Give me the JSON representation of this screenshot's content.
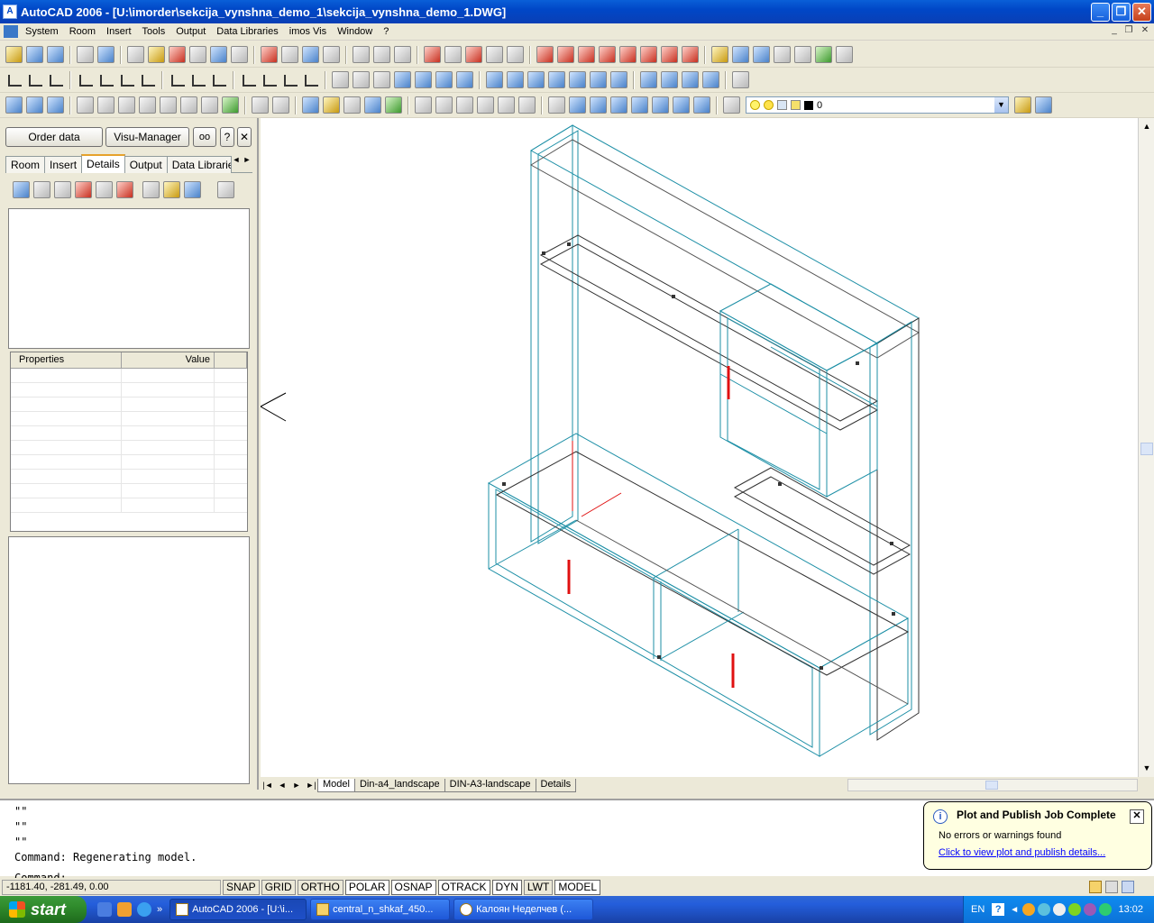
{
  "window": {
    "title": "AutoCAD 2006 - [U:\\imorder\\sekcija_vynshna_demo_1\\sekcija_vynshna_demo_1.DWG]"
  },
  "menu": [
    "System",
    "Room",
    "Insert",
    "Tools",
    "Output",
    "Data Libraries",
    "imos Vis",
    "Window",
    "?"
  ],
  "layer": {
    "current": "0"
  },
  "panel": {
    "order_button": "Order data",
    "visu_button": "Visu-Manager",
    "help_button": "?",
    "close_button": "✕",
    "tabs": [
      "Room",
      "Insert",
      "Details",
      "Output",
      "Data Libraries"
    ],
    "active_tab": "Details",
    "props_header": {
      "name": "Properties",
      "value": "Value"
    }
  },
  "layouts": {
    "tabs": [
      "Model",
      "Din-a4_landscape",
      "DIN-A3-landscape",
      "Details"
    ],
    "active": "Model"
  },
  "command": {
    "history": [
      "\"\"",
      "\"\"",
      "\"\"",
      "Command: Regenerating model."
    ],
    "prompt": "Command:"
  },
  "balloon": {
    "title": "Plot and Publish Job Complete",
    "message": "No errors or warnings found",
    "link": "Click to view plot and publish details..."
  },
  "status": {
    "coords": "-1181.40, -281.49, 0.00",
    "toggles": [
      {
        "label": "SNAP",
        "on": false
      },
      {
        "label": "GRID",
        "on": false
      },
      {
        "label": "ORTHO",
        "on": false
      },
      {
        "label": "POLAR",
        "on": true
      },
      {
        "label": "OSNAP",
        "on": true
      },
      {
        "label": "OTRACK",
        "on": true
      },
      {
        "label": "DYN",
        "on": true
      },
      {
        "label": "LWT",
        "on": false
      },
      {
        "label": "MODEL",
        "on": true
      }
    ]
  },
  "taskbar": {
    "start": "start",
    "tasks": [
      "AutoCAD 2006 - [U:\\i...",
      "central_n_shkaf_450...",
      "Калоян Неделчев (..."
    ],
    "language": "EN",
    "clock": "13:02"
  },
  "colors": {
    "titlebar": "#0047c7",
    "taskbar": "#245edb",
    "balloon": "#ffffe1",
    "cad_cyan": "#1d8fa6",
    "cad_red": "#e01010"
  }
}
